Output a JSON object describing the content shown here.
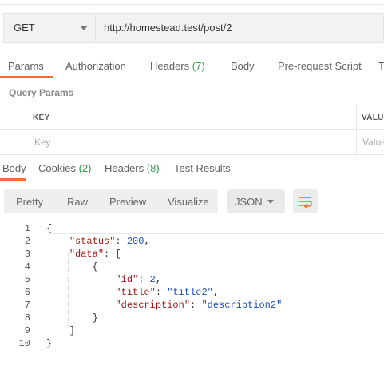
{
  "request": {
    "method": "GET",
    "url": "http://homestead.test/post/2"
  },
  "request_tabs": [
    {
      "label": "Params",
      "count": ""
    },
    {
      "label": "Authorization",
      "count": ""
    },
    {
      "label": "Headers",
      "count": "(7)"
    },
    {
      "label": "Body",
      "count": ""
    },
    {
      "label": "Pre-request Script",
      "count": ""
    },
    {
      "label": "T",
      "count": ""
    }
  ],
  "query_params": {
    "title": "Query Params",
    "key_header": "KEY",
    "value_header": "VALUE",
    "key_placeholder": "Key",
    "value_placeholder": "Value"
  },
  "response_tabs": [
    {
      "label": "Body",
      "count": ""
    },
    {
      "label": "Cookies",
      "count": "(2)"
    },
    {
      "label": "Headers",
      "count": "(8)"
    },
    {
      "label": "Test Results",
      "count": ""
    }
  ],
  "view_modes": [
    "Pretty",
    "Raw",
    "Preview",
    "Visualize"
  ],
  "format": "JSON",
  "code_lines": [
    {
      "n": "1",
      "tokens": [
        [
          "p",
          "{"
        ]
      ]
    },
    {
      "n": "2",
      "tokens": [
        [
          "p",
          "    "
        ],
        [
          "k",
          "\"status\""
        ],
        [
          "p",
          ": "
        ],
        [
          "n",
          "200"
        ],
        [
          "p",
          ","
        ]
      ]
    },
    {
      "n": "3",
      "tokens": [
        [
          "p",
          "    "
        ],
        [
          "k",
          "\"data\""
        ],
        [
          "p",
          ": ["
        ]
      ]
    },
    {
      "n": "4",
      "tokens": [
        [
          "p",
          "        {"
        ]
      ]
    },
    {
      "n": "5",
      "tokens": [
        [
          "p",
          "            "
        ],
        [
          "k",
          "\"id\""
        ],
        [
          "p",
          ": "
        ],
        [
          "n",
          "2"
        ],
        [
          "p",
          ","
        ]
      ]
    },
    {
      "n": "6",
      "tokens": [
        [
          "p",
          "            "
        ],
        [
          "k",
          "\"title\""
        ],
        [
          "p",
          ": "
        ],
        [
          "s",
          "\"title2\""
        ],
        [
          "p",
          ","
        ]
      ]
    },
    {
      "n": "7",
      "tokens": [
        [
          "p",
          "            "
        ],
        [
          "k",
          "\"description\""
        ],
        [
          "p",
          ": "
        ],
        [
          "s",
          "\"description2\""
        ]
      ]
    },
    {
      "n": "8",
      "tokens": [
        [
          "p",
          "        }"
        ]
      ]
    },
    {
      "n": "9",
      "tokens": [
        [
          "p",
          "    ]"
        ]
      ]
    },
    {
      "n": "10",
      "tokens": [
        [
          "p",
          "}"
        ]
      ]
    }
  ],
  "colors": {
    "accent": "#f26b3a",
    "count": "#2f9a4a",
    "json_key": "#a01a1a",
    "json_value": "#1a4fb8"
  },
  "icons": [
    "chevron-down-icon",
    "wrap-lines-icon"
  ]
}
